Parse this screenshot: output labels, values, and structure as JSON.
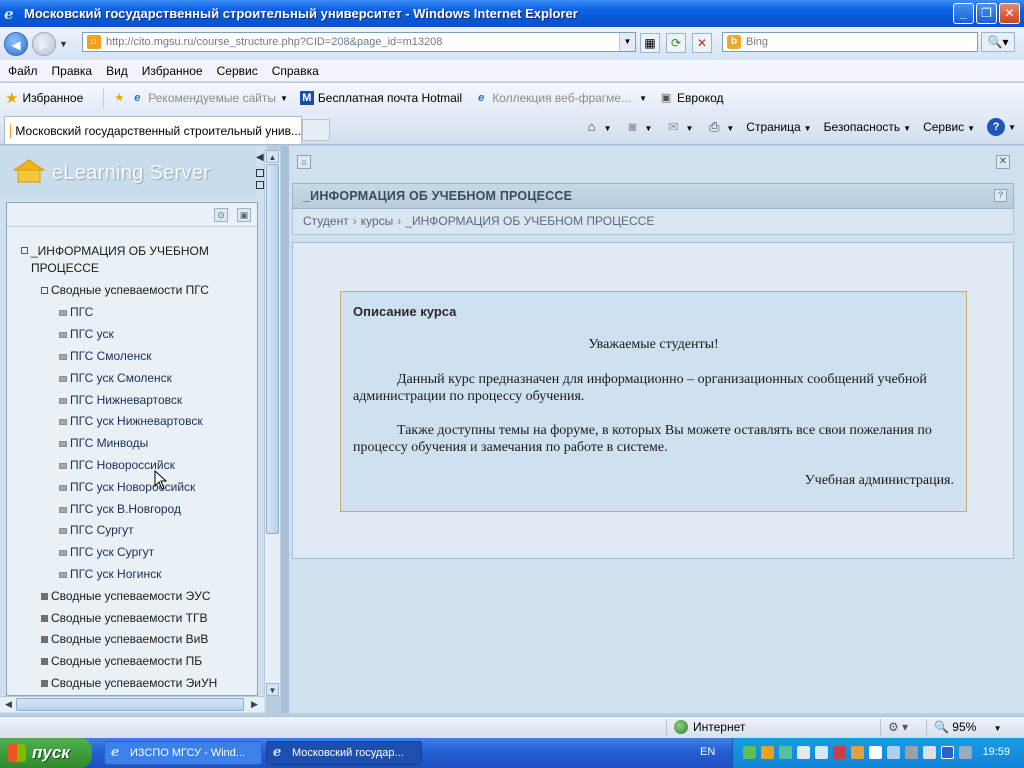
{
  "window": {
    "title": "Московский государственный строительный университет - Windows Internet Explorer",
    "buttons": [
      "_",
      "❐",
      "✕"
    ]
  },
  "address": {
    "url": "http://cito.mgsu.ru/course_structure.php?CID=208&page_id=m13208",
    "search_placeholder": "Bing"
  },
  "menubar": [
    "Файл",
    "Правка",
    "Вид",
    "Избранное",
    "Сервис",
    "Справка"
  ],
  "favorites": {
    "label": "Избранное",
    "items": [
      "Рекомендуемые сайты",
      "Бесплатная почта Hotmail",
      "Коллекция веб-фрагме...",
      "Еврокод"
    ]
  },
  "tab": {
    "label": "Московский государственный строительный унив..."
  },
  "commandbar": {
    "page": "Страница",
    "safety": "Безопасность",
    "tools": "Сервис"
  },
  "sidebar": {
    "logo": "eLearning Server",
    "tree": {
      "root": "_ИНФОРМАЦИЯ ОБ УЧЕБНОМ ПРОЦЕССЕ",
      "root_line1": "_ИНФОРМАЦИЯ ОБ УЧЕБНОМ",
      "root_line2": "ПРОЦЕССЕ",
      "groups": [
        {
          "label": "Сводные успеваемости ПГС",
          "children": [
            "ПГС",
            "ПГС уск",
            "ПГС Смоленск",
            "ПГС уск Смоленск",
            "ПГС Нижневартовск",
            "ПГС уск Нижневартовск",
            "ПГС Минводы",
            "ПГС Новороссийск",
            "ПГС уск Новороссийск",
            "ПГС уск В.Новгород",
            "ПГС Сургут",
            "ПГС уск Сургут",
            "ПГС уск Ногинск"
          ]
        },
        {
          "label": "Сводные успеваемости ЭУС"
        },
        {
          "label": "Сводные успеваемости ТГВ"
        },
        {
          "label": "Сводные успеваемости ВиВ"
        },
        {
          "label": "Сводные успеваемости ПБ"
        },
        {
          "label": "Сводные успеваемости ЭиУН"
        }
      ]
    }
  },
  "content": {
    "section_title": "_ИНФОРМАЦИЯ ОБ УЧЕБНОМ ПРОЦЕССЕ",
    "breadcrumbs": [
      "Студент",
      "курсы",
      "_ИНФОРМАЦИЯ ОБ УЧЕБНОМ ПРОЦЕССЕ"
    ],
    "course": {
      "heading": "Описание курса",
      "greeting": "Уважаемые студенты!",
      "para1": "Данный курс предназначен для информационно – организационных сообщений учебной администрации по процессу обучения.",
      "para2": "Также доступны темы на форуме, в которых Вы можете оставлять  все свои пожелания по процессу обучения и замечания по работе в системе.",
      "signature": "Учебная администрация."
    }
  },
  "statusbar": {
    "zone": "Интернет",
    "zoom": "95%"
  },
  "taskbar": {
    "start": "пуск",
    "tasks": [
      "ИЗСПО МГСУ - Wind...",
      "Московский государ..."
    ],
    "lang": "EN",
    "clock": "19:59"
  }
}
